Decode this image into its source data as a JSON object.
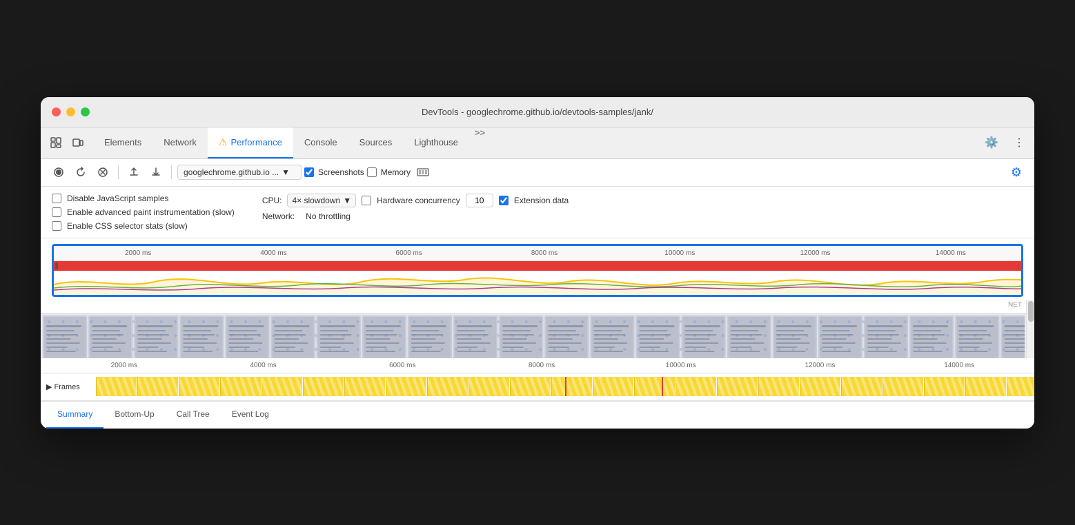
{
  "window": {
    "title": "DevTools - googlechrome.github.io/devtools-samples/jank/"
  },
  "tabs": {
    "items": [
      {
        "label": "Elements",
        "active": false
      },
      {
        "label": "Network",
        "active": false
      },
      {
        "label": "Performance",
        "active": true,
        "warning": true
      },
      {
        "label": "Console",
        "active": false
      },
      {
        "label": "Sources",
        "active": false
      },
      {
        "label": "Lighthouse",
        "active": false
      },
      {
        "label": ">>",
        "active": false
      }
    ]
  },
  "toolbar": {
    "url": "googlechrome.github.io ...",
    "screenshots_label": "Screenshots",
    "memory_label": "Memory"
  },
  "settings": {
    "disable_js_label": "Disable JavaScript samples",
    "advanced_paint_label": "Enable advanced paint instrumentation (slow)",
    "css_stats_label": "Enable CSS selector stats (slow)",
    "cpu_label": "CPU:",
    "cpu_value": "4× slowdown",
    "network_label": "Network:",
    "network_value": "No throttling",
    "hw_concurrency_label": "Hardware concurrency",
    "hw_concurrency_value": "10",
    "extension_data_label": "Extension data"
  },
  "ruler": {
    "ticks": [
      "2000 ms",
      "4000 ms",
      "6000 ms",
      "8000 ms",
      "10000 ms",
      "12000 ms",
      "14000 ms"
    ]
  },
  "bottom_tabs": {
    "items": [
      {
        "label": "Summary",
        "active": true
      },
      {
        "label": "Bottom-Up",
        "active": false
      },
      {
        "label": "Call Tree",
        "active": false
      },
      {
        "label": "Event Log",
        "active": false
      }
    ]
  },
  "frames_label": "▶ Frames",
  "net_label": "NET"
}
